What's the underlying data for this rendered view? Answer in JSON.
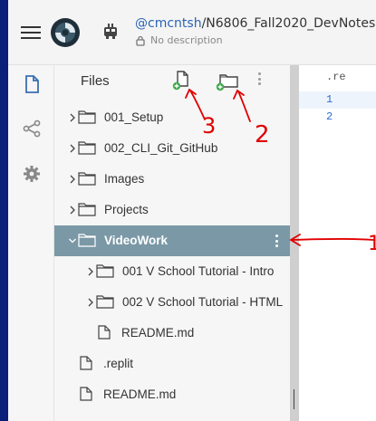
{
  "header": {
    "repo_owner": "@cmcntsh",
    "repo_separator": "/",
    "repo_name": "N6806_Fall2020_DevNotes",
    "description": "No description"
  },
  "rail": {
    "icons": [
      "files-icon",
      "share-icon",
      "settings-icon"
    ]
  },
  "files_panel": {
    "title": "Files",
    "add_file_icon": "new-file-icon",
    "add_folder_icon": "new-folder-icon"
  },
  "tree": [
    {
      "label": "001_Setup",
      "type": "folder",
      "depth": 0,
      "expanded": false
    },
    {
      "label": "002_CLI_Git_GitHub",
      "type": "folder",
      "depth": 0,
      "expanded": false
    },
    {
      "label": "Images",
      "type": "folder",
      "depth": 0,
      "expanded": false
    },
    {
      "label": "Projects",
      "type": "folder",
      "depth": 0,
      "expanded": false
    },
    {
      "label": "VideoWork",
      "type": "folder",
      "depth": 0,
      "expanded": true,
      "selected": true
    },
    {
      "label": "001 V School Tutorial - Intro",
      "type": "folder",
      "depth": 1,
      "expanded": false
    },
    {
      "label": "002 V School Tutorial - HTML",
      "type": "folder",
      "depth": 1,
      "expanded": false
    },
    {
      "label": "README.md",
      "type": "file",
      "depth": 1
    },
    {
      "label": ".replit",
      "type": "file",
      "depth": 0
    },
    {
      "label": "README.md",
      "type": "file",
      "depth": 0
    }
  ],
  "editor": {
    "tab_label": ".re",
    "line_numbers": [
      "1",
      "2"
    ]
  },
  "annotations": {
    "numbers": [
      "3",
      "2",
      "1"
    ],
    "color": "#e00000"
  },
  "colors": {
    "selected_row": "#7b98a6",
    "link": "#2b63b5",
    "accent_green": "#3ea84a"
  }
}
